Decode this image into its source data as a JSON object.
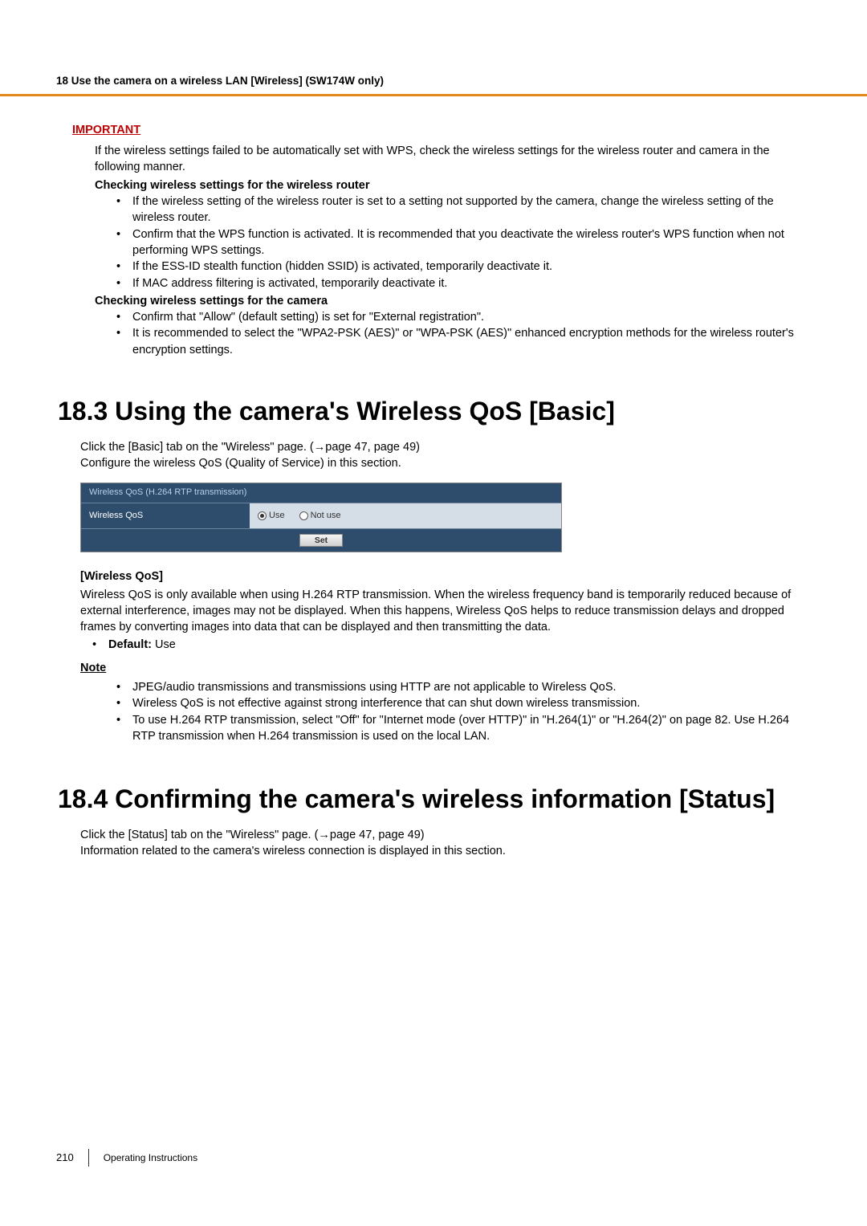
{
  "header": {
    "chapter": "18 Use the camera on a wireless LAN [Wireless] (SW174W only)"
  },
  "important": {
    "label": "IMPORTANT",
    "intro": "If the wireless settings failed to be automatically set with WPS, check the wireless settings for the wireless router and camera in the following manner.",
    "routerHeading": "Checking wireless settings for the wireless router",
    "routerBullets": [
      "If the wireless setting of the wireless router is set to a setting not supported by the camera, change the wireless setting of the wireless router.",
      "Confirm that the WPS function is activated. It is recommended that you deactivate the wireless router's WPS function when not performing WPS settings.",
      "If the ESS-ID stealth function (hidden SSID) is activated, temporarily deactivate it.",
      "If MAC address filtering is activated, temporarily deactivate it."
    ],
    "cameraHeading": "Checking wireless settings for the camera",
    "cameraBullets": [
      "Confirm that \"Allow\" (default setting) is set for \"External registration\".",
      "It is recommended to select the \"WPA2-PSK (AES)\" or \"WPA-PSK (AES)\" enhanced encryption methods for the wireless router's encryption settings."
    ]
  },
  "section183": {
    "heading": "18.3  Using the camera's Wireless QoS [Basic]",
    "line1": "Click the [Basic] tab on the \"Wireless\" page. (→page 47, page 49)",
    "line2": "Configure the wireless QoS (Quality of Service) in this section.",
    "panel": {
      "title": "Wireless QoS (H.264 RTP transmission)",
      "rowLabel": "Wireless QoS",
      "optUse": "Use",
      "optNotUse": "Not use",
      "setBtn": "Set"
    },
    "wqosHeading": "[Wireless QoS]",
    "wqosBody": "Wireless QoS is only available when using H.264 RTP transmission. When the wireless frequency band is temporarily reduced because of external interference, images may not be displayed. When this happens, Wireless QoS helps to reduce transmission delays and dropped frames by converting images into data that can be displayed and then transmitting the data.",
    "defaultLabel": "Default:",
    "defaultValue": " Use",
    "noteLabel": "Note",
    "noteBullets": [
      "JPEG/audio transmissions and transmissions using HTTP are not applicable to Wireless QoS.",
      "Wireless QoS is not effective against strong interference that can shut down wireless transmission.",
      "To use H.264 RTP transmission, select \"Off\" for \"Internet mode (over HTTP)\" in \"H.264(1)\" or \"H.264(2)\" on page 82. Use H.264 RTP transmission when H.264 transmission is used on the local LAN."
    ]
  },
  "section184": {
    "heading": "18.4  Confirming the camera's wireless information [Status]",
    "line1": "Click the [Status] tab on the \"Wireless\" page. (→page 47, page 49)",
    "line2": "Information related to the camera's wireless connection is displayed in this section."
  },
  "footer": {
    "pageNum": "210",
    "docTitle": "Operating Instructions"
  }
}
